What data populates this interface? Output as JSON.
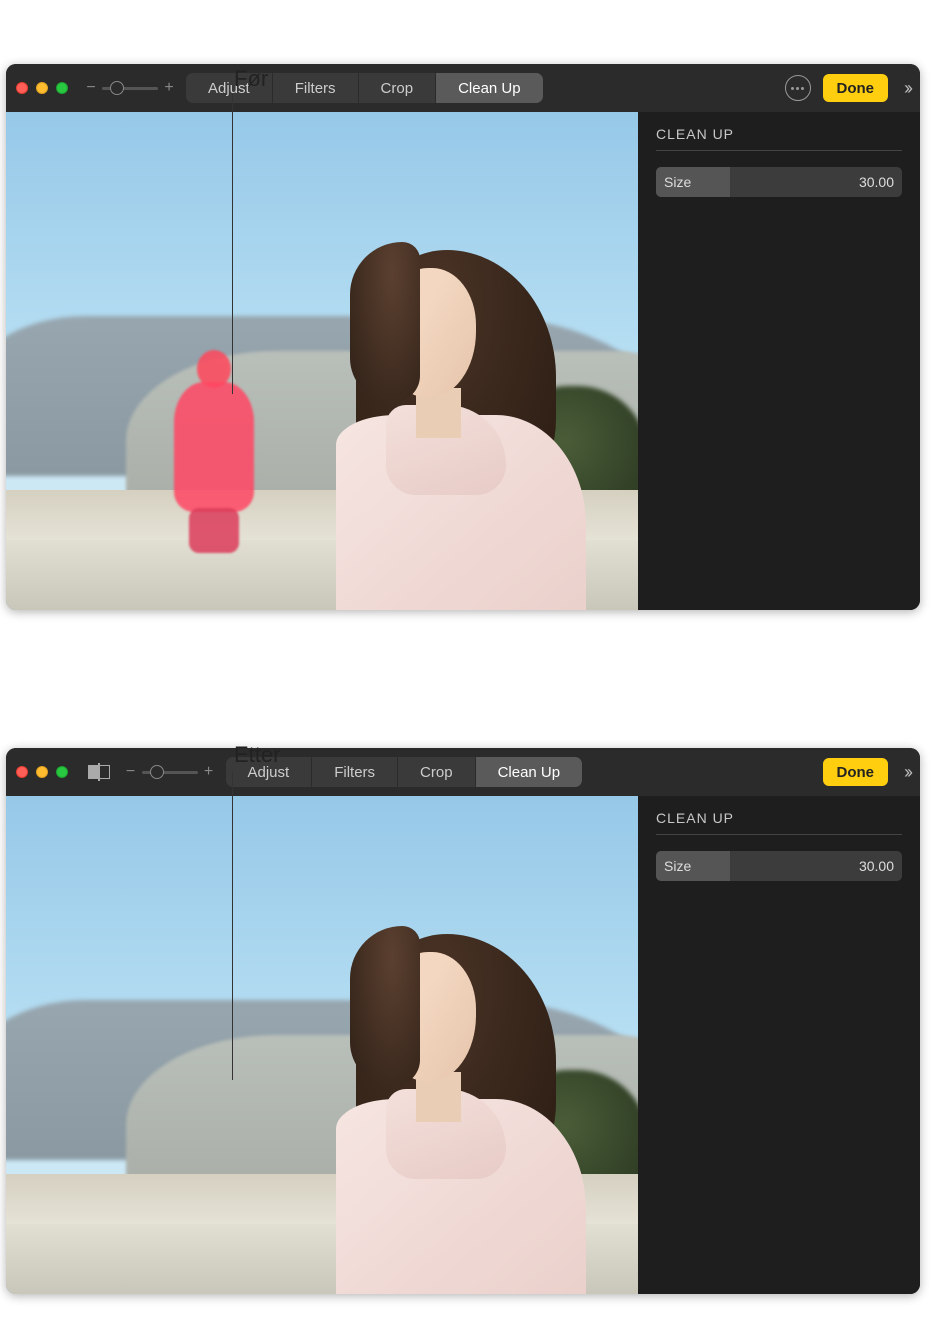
{
  "callouts": {
    "before_label": "Før",
    "after_label": "Etter"
  },
  "window_before": {
    "tabs": [
      "Adjust",
      "Filters",
      "Crop",
      "Clean Up"
    ],
    "active_tab": "Clean Up",
    "done_label": "Done",
    "sidebar": {
      "title": "CLEAN UP",
      "size_label": "Size",
      "size_value": "30.00"
    }
  },
  "window_after": {
    "tabs": [
      "Adjust",
      "Filters",
      "Crop",
      "Clean Up"
    ],
    "active_tab": "Clean Up",
    "done_label": "Done",
    "sidebar": {
      "title": "CLEAN UP",
      "size_label": "Size",
      "size_value": "30.00"
    }
  }
}
